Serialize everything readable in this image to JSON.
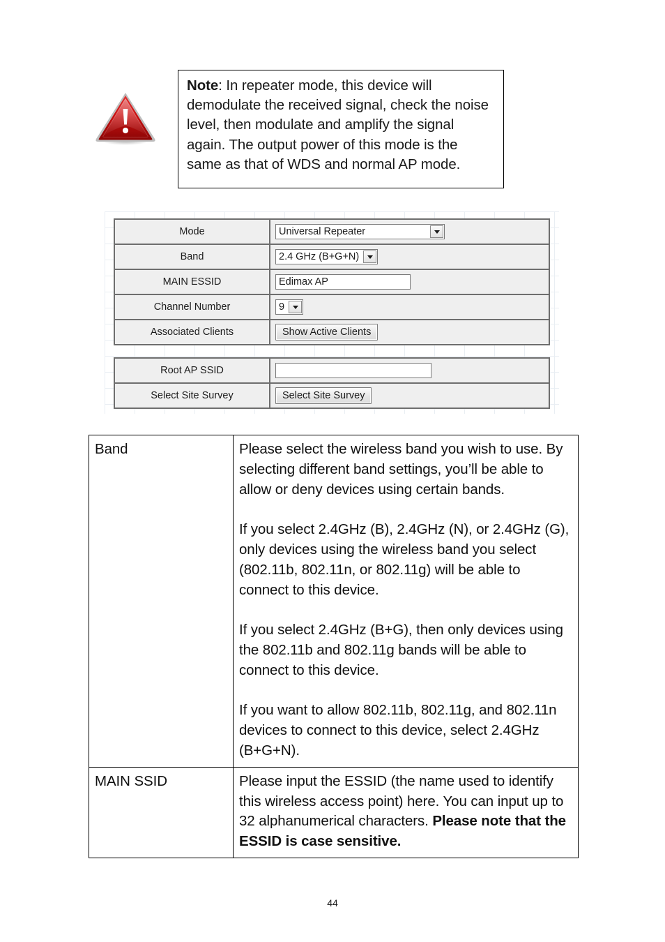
{
  "note": {
    "icon": "warning-triangle-icon",
    "label_bold": "Note",
    "text_plain": ": In repeater mode, this device will demodulate the received signal, check the noise level, then modulate and amplify the signal again. The output power of this mode is the same as that of WDS and normal AP mode."
  },
  "settings_screenshot": {
    "top_table": [
      {
        "label": "Mode",
        "control": "select",
        "value": "Universal Repeater"
      },
      {
        "label": "Band",
        "control": "select",
        "value": "2.4 GHz (B+G+N)"
      },
      {
        "label": "MAIN ESSID",
        "control": "text",
        "value": "Edimax AP"
      },
      {
        "label": "Channel Number",
        "control": "select",
        "value": "9"
      },
      {
        "label": "Associated Clients",
        "control": "button",
        "value": "Show Active Clients"
      }
    ],
    "bottom_table": [
      {
        "label": "Root AP SSID",
        "control": "text",
        "value": ""
      },
      {
        "label": "Select Site Survey",
        "control": "button",
        "value": "Select Site Survey"
      }
    ]
  },
  "description_table": {
    "rows": [
      {
        "term": "Band",
        "definition": "Please select the wireless band you wish to use. By selecting different band settings, you’ll be able to allow or deny devices using certain bands.\n\nIf you select 2.4GHz (B), 2.4GHz (N), or 2.4GHz (G), only devices using the wireless band you select (802.11b, 802.11n, or 802.11g) will be able to connect to this device.\n\nIf you select 2.4GHz (B+G), then only devices using the 802.11b and 802.11g bands will be able to connect to this device.\n\nIf you want to allow 802.11b, 802.11g, and 802.11n devices to connect to this device, select 2.4GHz (B+G+N)."
      },
      {
        "term": "MAIN SSID",
        "definition_plain": "Please input the ESSID (the name used to identify this wireless access point) here. You can input up to 32 alphanumerical characters. ",
        "definition_bold": "Please note that the ESSID is case sensitive."
      }
    ]
  },
  "page_number": "44",
  "colors": {
    "warning_red": "#cf1616",
    "warning_red_dark": "#a30d0d",
    "warning_border": "#b9b9b9",
    "ui_panel_gray": "#efefef",
    "ui_border_gray": "#6e6e6e",
    "grid_line": "#e9eef3"
  }
}
